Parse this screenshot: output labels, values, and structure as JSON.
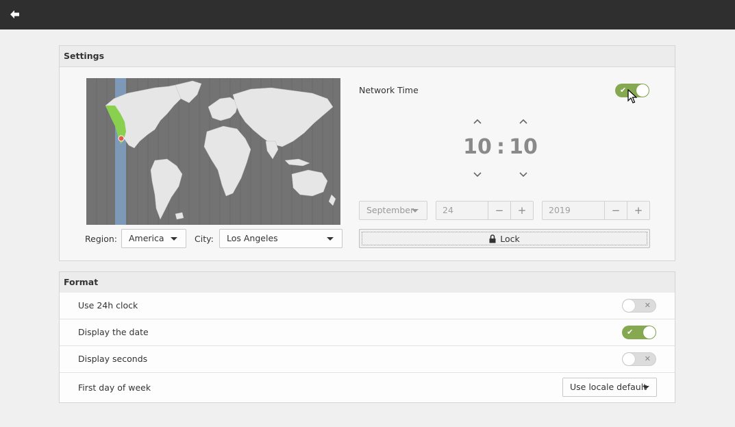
{
  "topbar": {
    "back_icon": "back-arrow-icon"
  },
  "settings": {
    "header": "Settings",
    "region_label": "Region:",
    "region_value": "America",
    "city_label": "City:",
    "city_value": "Los Angeles",
    "network_time_label": "Network Time",
    "network_time_on": true,
    "hour": "10",
    "separator": ":",
    "minute": "10",
    "month": "September",
    "day": "24",
    "year": "2019",
    "minus": "−",
    "plus": "+",
    "lock_label": "Lock"
  },
  "format": {
    "header": "Format",
    "rows": [
      {
        "label": "Use 24h clock",
        "on": false
      },
      {
        "label": "Display the date",
        "on": true
      },
      {
        "label": "Display seconds",
        "on": false
      }
    ],
    "first_day_label": "First day of week",
    "first_day_value": "Use locale default"
  },
  "colors": {
    "accent": "#86a850",
    "timezone_band": "#7e98b8",
    "topbar": "#2f2f2f"
  }
}
